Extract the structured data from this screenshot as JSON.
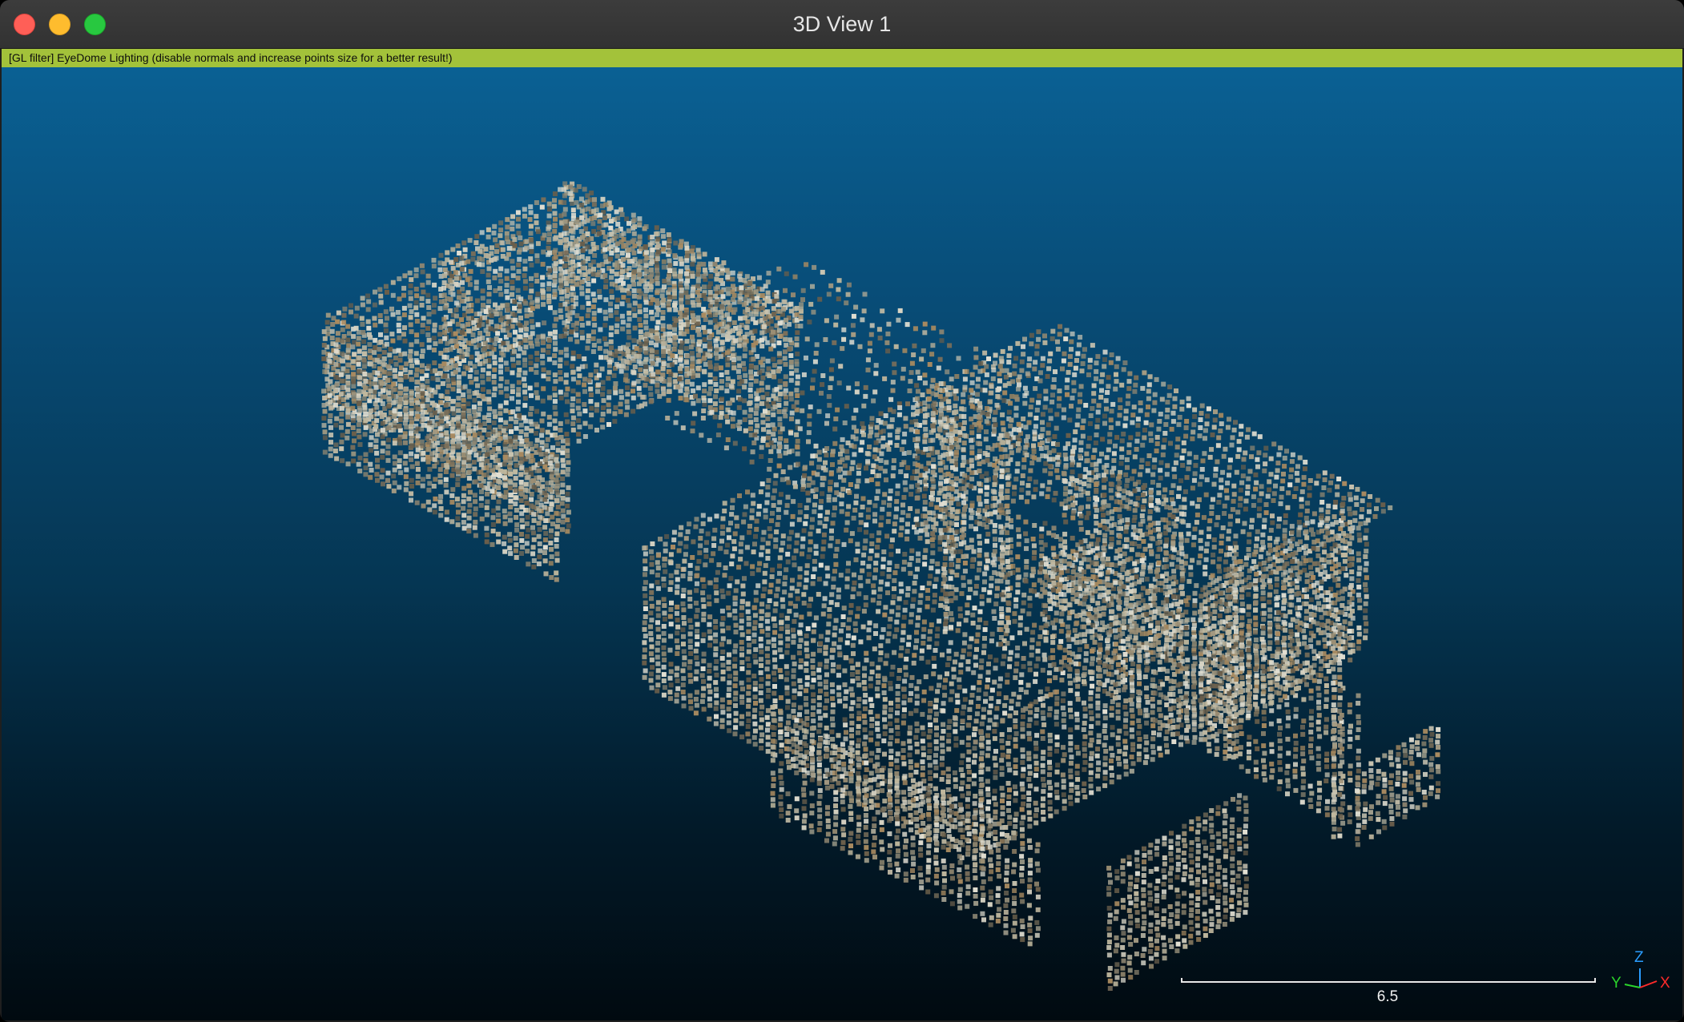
{
  "window": {
    "title": "3D View 1",
    "controls": {
      "close": "close-button",
      "minimize": "minimize-button",
      "maximize": "maximize-button"
    }
  },
  "viewport": {
    "filter_message": "[GL filter] EyeDome Lighting (disable normals and increase points size for a better result!)",
    "scale_bar_value": "6.5",
    "axes": {
      "y_label": "Y",
      "z_label": "Z",
      "x_label": "X",
      "colors": {
        "x": "#ff2a2a",
        "y": "#2ad52a",
        "z": "#2a9dff"
      }
    },
    "colors": {
      "background_top": "#0a6296",
      "background_bottom": "#010a10",
      "filter_bar": "#a3c23a"
    }
  }
}
